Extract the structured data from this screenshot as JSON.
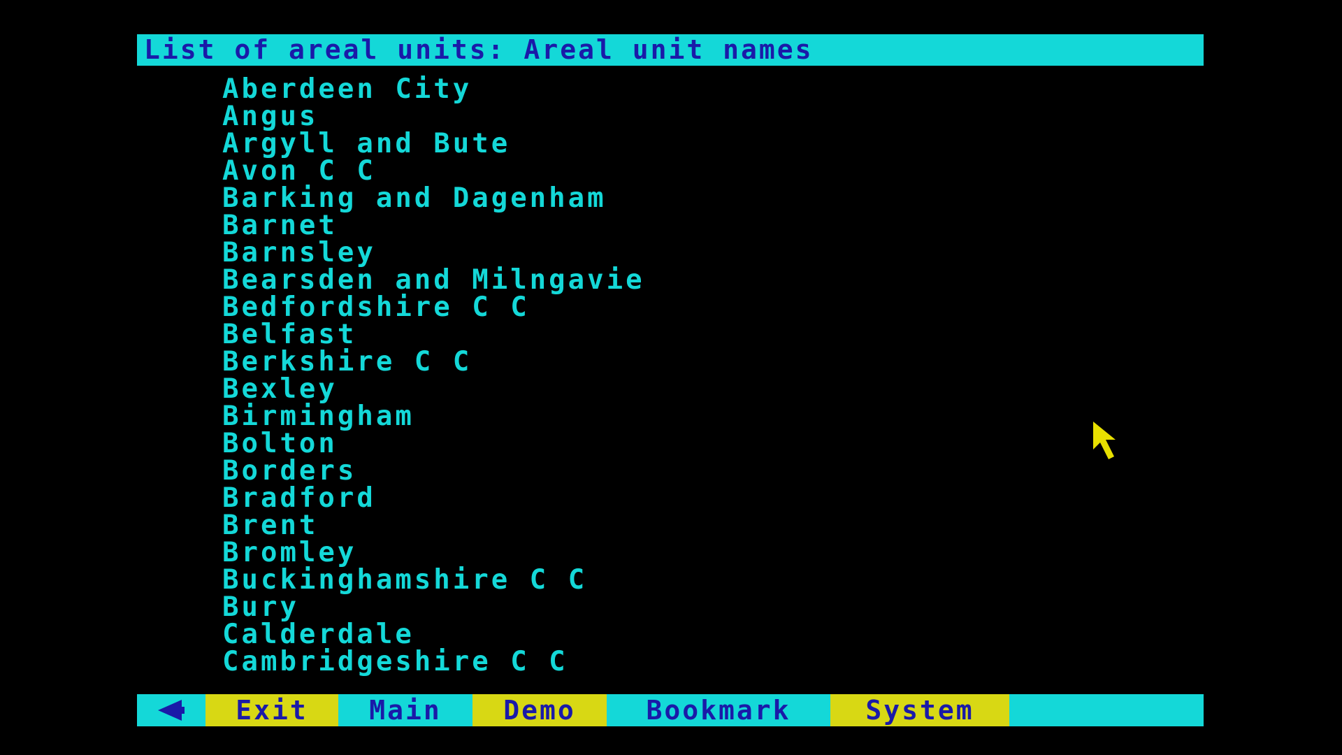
{
  "title": "List of areal units: Areal unit names",
  "areal_units": [
    "Aberdeen City",
    "Angus",
    "Argyll and Bute",
    "Avon C C",
    "Barking and Dagenham",
    "Barnet",
    "Barnsley",
    "Bearsden and Milngavie",
    "Bedfordshire C C",
    "Belfast",
    "Berkshire C C",
    "Bexley",
    "Birmingham",
    "Bolton",
    "Borders",
    "Bradford",
    "Brent",
    "Bromley",
    "Buckinghamshire C C",
    "Bury",
    "Calderdale",
    "Cambridgeshire C C"
  ],
  "menu": {
    "back_icon": "left-arrow-icon",
    "exit": "Exit",
    "main": "Main",
    "demo": "Demo",
    "bookmark": "Bookmark",
    "system": "System"
  },
  "colors": {
    "background": "#000000",
    "cyan": "#14d8d8",
    "yellow": "#d8d814",
    "blue_text": "#1a1aa8",
    "cursor": "#e8e000"
  }
}
